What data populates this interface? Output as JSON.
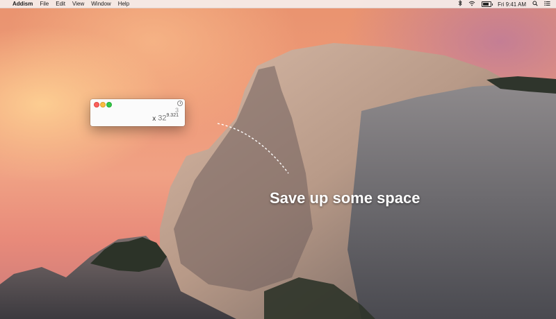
{
  "menubar": {
    "apple": "",
    "app_name": "Addism",
    "items": [
      "File",
      "Edit",
      "View",
      "Window",
      "Help"
    ],
    "status": {
      "clock": "Fri 9:41 AM",
      "battery_level": 0.8,
      "icons": [
        "bluetooth-icon",
        "wifi-icon",
        "battery-icon",
        "search-icon",
        "list-icon"
      ]
    }
  },
  "calculator": {
    "line1": "3",
    "line2_operator": "x",
    "line2_base": "32",
    "line2_superscript": "9.321"
  },
  "promo": {
    "headline": "Save up some space"
  },
  "colors": {
    "accent_close": "#fc605c",
    "accent_minimize": "#fdbc40",
    "accent_zoom": "#34c84a"
  }
}
